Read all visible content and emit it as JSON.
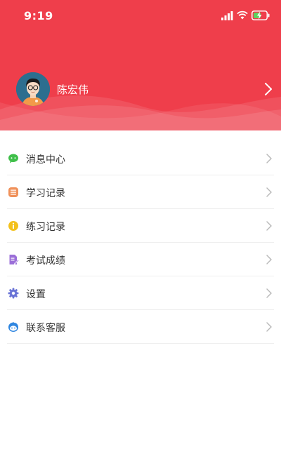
{
  "status_bar": {
    "time": "9:19"
  },
  "profile": {
    "name": "陈宏伟",
    "avatar_icon": "user-avatar-icon"
  },
  "menu": {
    "items": [
      {
        "label": "消息中心",
        "icon": "message-icon",
        "color": "#3fbf4a"
      },
      {
        "label": "学习记录",
        "icon": "study-record-icon",
        "color": "#f0915a"
      },
      {
        "label": "练习记录",
        "icon": "practice-record-icon",
        "color": "#f3c11c"
      },
      {
        "label": "考试成绩",
        "icon": "exam-score-icon",
        "color": "#9b6fd8"
      },
      {
        "label": "设置",
        "icon": "settings-icon",
        "color": "#6a74d6"
      },
      {
        "label": "联系客服",
        "icon": "customer-service-icon",
        "color": "#2f86e0"
      }
    ]
  },
  "colors": {
    "header_red": "#ef3e4b",
    "text_dark": "#333333",
    "chevron_gray": "#b8b8b8",
    "divider": "#eeeeee"
  }
}
